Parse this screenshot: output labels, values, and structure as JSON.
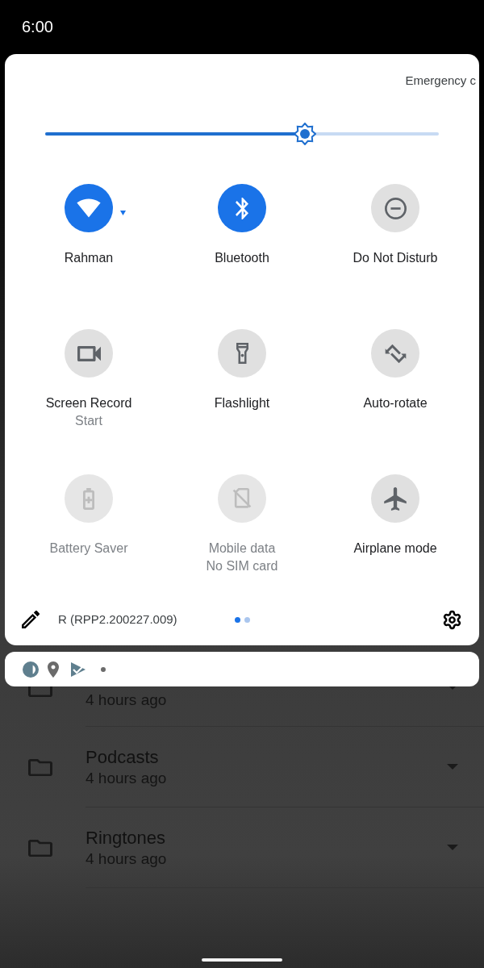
{
  "status_bar": {
    "time": "6:00"
  },
  "quick_settings": {
    "emergency_label": "Emergency c",
    "brightness": {
      "level": 0.66
    },
    "tiles": [
      {
        "label": "Rahman",
        "on": true,
        "disabled": false,
        "dropdown": true
      },
      {
        "label": "Bluetooth",
        "on": true,
        "disabled": false,
        "dropdown": false
      },
      {
        "label": "Do Not Disturb",
        "on": false,
        "disabled": false,
        "dropdown": false
      },
      {
        "label": "Screen Record",
        "secondary": "Start",
        "on": false,
        "disabled": false,
        "dropdown": false
      },
      {
        "label": "Flashlight",
        "on": false,
        "disabled": false,
        "dropdown": false
      },
      {
        "label": "Auto-rotate",
        "on": false,
        "disabled": false,
        "dropdown": false
      },
      {
        "label": "Battery Saver",
        "on": false,
        "disabled": true,
        "dropdown": false
      },
      {
        "label": "Mobile data",
        "secondary": "No SIM card",
        "on": false,
        "disabled": true,
        "dropdown": false
      },
      {
        "label": "Airplane mode",
        "on": false,
        "disabled": false,
        "dropdown": false
      }
    ],
    "footer": {
      "build": "R (RPP2.200227.009)",
      "pages": [
        {
          "selected": true
        },
        {
          "selected": false
        }
      ]
    }
  },
  "files": [
    {
      "subtitle": "4 hours ago"
    },
    {
      "title": "Podcasts",
      "subtitle": "4 hours ago"
    },
    {
      "title": "Ringtones",
      "subtitle": "4 hours ago"
    }
  ]
}
